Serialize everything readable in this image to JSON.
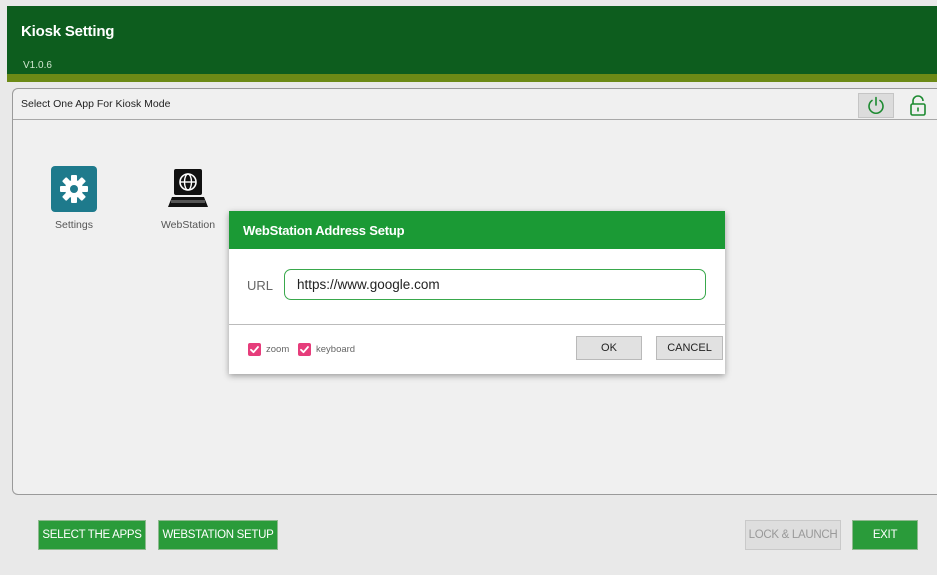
{
  "header": {
    "title": "Kiosk Setting",
    "version": "V1.0.6"
  },
  "panel": {
    "label": "Select One App For Kiosk Mode"
  },
  "apps": [
    {
      "name": "Settings",
      "icon": "gear-icon"
    },
    {
      "name": "WebStation",
      "icon": "globe-monitor-icon"
    }
  ],
  "dialog": {
    "title": "WebStation Address Setup",
    "url_label": "URL",
    "url_value": "https://www.google.com",
    "zoom_label": "zoom",
    "keyboard_label": "keyboard",
    "zoom_checked": true,
    "keyboard_checked": true,
    "ok_label": "OK",
    "cancel_label": "CANCEL"
  },
  "footer": {
    "select_apps": "SELECT THE APPS",
    "webstation_setup": "WEBSTATION SETUP",
    "lock_launch": "LOCK & LAUNCH",
    "exit": "EXIT"
  },
  "colors": {
    "header": "#0d5d1e",
    "accent_green": "#1b9a35",
    "checkbox": "#e63d7b"
  }
}
